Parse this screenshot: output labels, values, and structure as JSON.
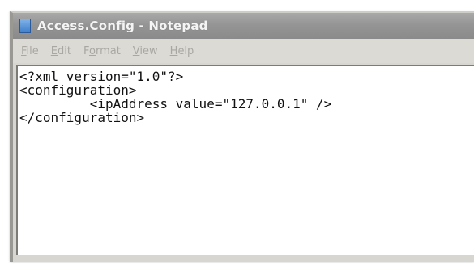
{
  "window": {
    "title": "Access.Config - Notepad",
    "icon": "notepad-icon"
  },
  "menu": {
    "items": [
      {
        "label_first": "F",
        "label_rest": "ile"
      },
      {
        "label_first": "E",
        "label_rest": "dit"
      },
      {
        "label_first": "F",
        "label_rest": "ormat",
        "underline_index": 1,
        "pre": "F",
        "u": "o",
        "post": "rmat"
      },
      {
        "label_first": "V",
        "label_rest": "iew"
      },
      {
        "label_first": "H",
        "label_rest": "elp"
      }
    ]
  },
  "editor": {
    "content": "<?xml version=\"1.0\"?>\n<configuration>\n         <ipAddress value=\"127.0.0.1\" />\n</configuration>"
  }
}
